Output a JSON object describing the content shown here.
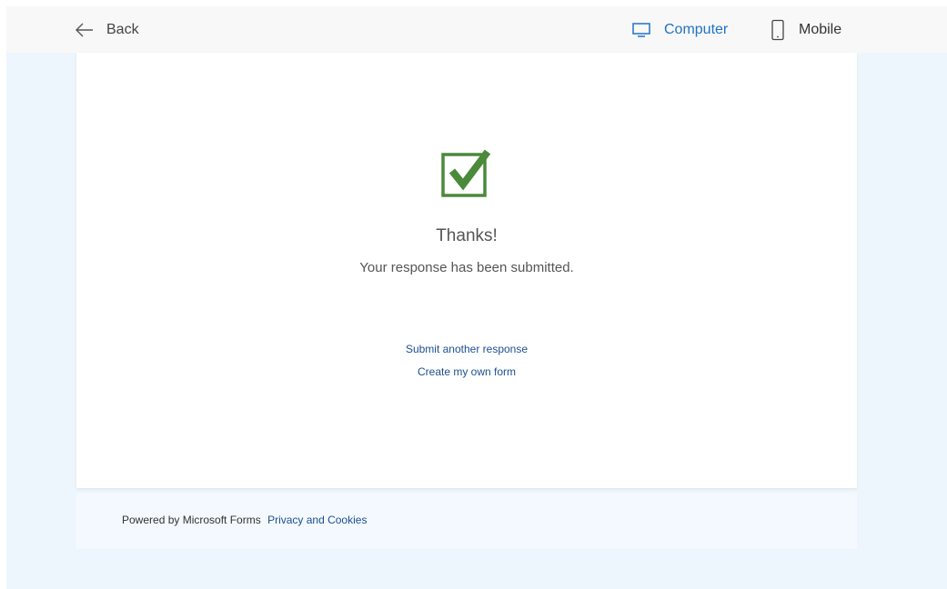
{
  "topbar": {
    "back_label": "Back",
    "computer_label": "Computer",
    "mobile_label": "Mobile"
  },
  "confirmation": {
    "title": "Thanks!",
    "message": "Your response has been submitted.",
    "submit_another": "Submit another response",
    "create_form": "Create my own form"
  },
  "footer": {
    "powered_by": "Powered by Microsoft Forms",
    "privacy": "Privacy and Cookies"
  },
  "colors": {
    "accent": "#1f73c6",
    "link": "#1d4f91",
    "check_green": "#4a8a3a",
    "page_bg": "#edf6fd"
  }
}
